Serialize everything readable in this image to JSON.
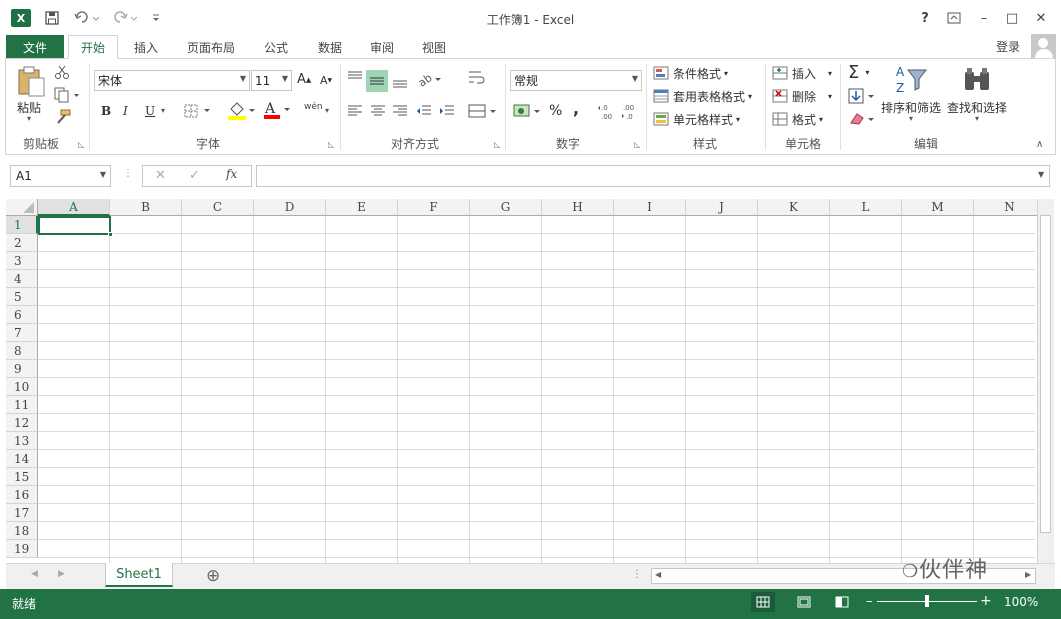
{
  "window": {
    "title": "工作簿1 - Excel",
    "controls": {
      "help": "?",
      "minimize": "–",
      "maximize": "□",
      "close": "✕"
    }
  },
  "quick_access": {
    "logo": "X",
    "save_icon": "save-icon",
    "undo_icon": "undo-icon",
    "redo_icon": "redo-icon"
  },
  "tabs": {
    "file": "文件",
    "items": [
      {
        "label": "开始",
        "active": true
      },
      {
        "label": "插入"
      },
      {
        "label": "页面布局"
      },
      {
        "label": "公式"
      },
      {
        "label": "数据"
      },
      {
        "label": "审阅"
      },
      {
        "label": "视图"
      }
    ],
    "login": "登录"
  },
  "ribbon": {
    "clipboard": {
      "paste": "粘贴",
      "group": "剪贴板"
    },
    "font": {
      "name": "宋体",
      "size": "11",
      "bold": "B",
      "italic": "I",
      "underline": "U",
      "grow": "A",
      "shrink": "A",
      "font_color": "A",
      "phonetic": "wén",
      "group": "字体"
    },
    "alignment": {
      "group": "对齐方式"
    },
    "number": {
      "format": "常规",
      "percent": "%",
      "comma": ",",
      "group": "数字"
    },
    "styles": {
      "conditional": "条件格式",
      "table": "套用表格格式",
      "cell": "单元格样式",
      "group": "样式"
    },
    "cells": {
      "insert": "插入",
      "delete": "删除",
      "format": "格式",
      "group": "单元格"
    },
    "editing": {
      "sum": "Σ",
      "sort": "排序和筛选",
      "find": "查找和选择",
      "group": "编辑"
    }
  },
  "formula_bar": {
    "name_box": "A1",
    "cancel": "✕",
    "enter": "✓",
    "fx": "fx",
    "value": ""
  },
  "grid": {
    "columns": [
      "A",
      "B",
      "C",
      "D",
      "E",
      "F",
      "G",
      "H",
      "I",
      "J",
      "K",
      "L",
      "M",
      "N"
    ],
    "rows": [
      "1",
      "2",
      "3",
      "4",
      "5",
      "6",
      "7",
      "8",
      "9",
      "10",
      "11",
      "12",
      "13",
      "14",
      "15",
      "16",
      "17",
      "18",
      "19"
    ],
    "selected_col": "A",
    "selected_row": "1"
  },
  "sheets": {
    "tabs": [
      "Sheet1"
    ],
    "add": "⊕"
  },
  "status": {
    "text": "就绪",
    "zoom": "100%",
    "zoom_minus": "–",
    "zoom_plus": "+",
    "zoom_level": 1.0
  },
  "watermark": "伙伴神",
  "colors": {
    "accent": "#217346",
    "file_tab": "#217346",
    "status_bar": "#217346"
  }
}
